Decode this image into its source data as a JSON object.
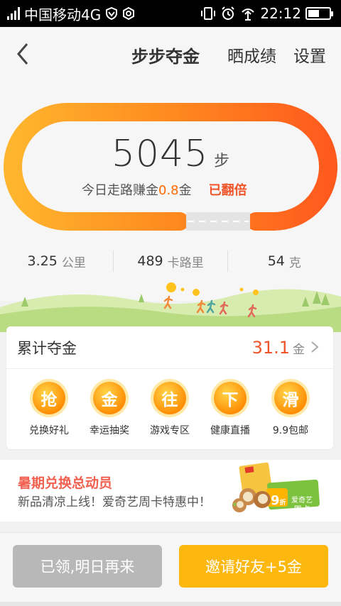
{
  "status_bar": {
    "carrier": "中国移动4G",
    "time": "22:12",
    "battery_level": 0.55
  },
  "header": {
    "title": "步步夺金",
    "share_label": "晒成绩",
    "settings_label": "设置"
  },
  "hero": {
    "steps": "5045",
    "steps_unit": "步",
    "earn_prefix": "今日走路赚金",
    "earn_amount": "0.8",
    "earn_suffix": "金",
    "doubled_label": "已翻倍"
  },
  "stats": [
    {
      "value": "3.25",
      "unit": "公里"
    },
    {
      "value": "489",
      "unit": "卡路里"
    },
    {
      "value": "54",
      "unit": "克"
    }
  ],
  "card": {
    "title": "累计夺金",
    "total_value": "31.1",
    "total_unit": "金",
    "items": [
      {
        "glyph": "抢",
        "label": "兑换好礼"
      },
      {
        "glyph": "金",
        "label": "幸运抽奖"
      },
      {
        "glyph": "往",
        "label": "游戏专区"
      },
      {
        "glyph": "下",
        "label": "健康直播"
      },
      {
        "glyph": "滑",
        "label": "9.9包邮"
      }
    ]
  },
  "promo": {
    "title": "暑期兑换总动员",
    "subtitle": "新品清凉上线！爱奇艺周卡特惠中！",
    "badge_number": "9",
    "badge_unit": "折",
    "card_brand": "爱奇艺",
    "card_type": "周卡"
  },
  "buttons": {
    "claimed_label": "已领,明日再来",
    "invite_label": "邀请好友+5金"
  },
  "colors": {
    "accent_orange": "#ff6a00",
    "gold": "#fdb80f",
    "red_text": "#f0552a"
  }
}
